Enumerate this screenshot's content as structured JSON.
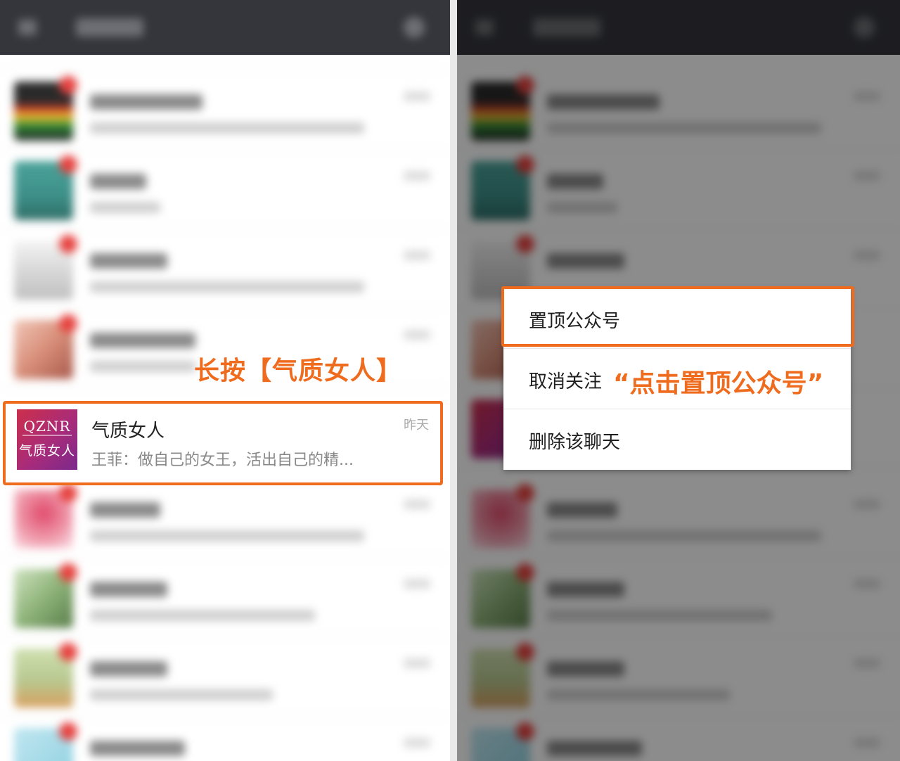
{
  "left_panel": {
    "highlighted_chat": {
      "logo_line1": "QZNR",
      "logo_line2": "气质女人",
      "name": "气质女人",
      "last_message": "王菲：做自己的女王，活出自己的精...",
      "time": "昨天"
    },
    "hint": "长按【气质女人】"
  },
  "right_panel": {
    "context_menu": {
      "items": [
        "置顶公众号",
        "取消关注",
        "删除该聊天"
      ]
    },
    "hint": "“点击置顶公众号”"
  },
  "colors": {
    "highlight": "#ef6c1f",
    "app_bar": "#35363c",
    "unread_dot": "#e64340"
  },
  "icons": [
    "back-arrow-icon",
    "search-icon",
    "unread-badge-icon"
  ]
}
